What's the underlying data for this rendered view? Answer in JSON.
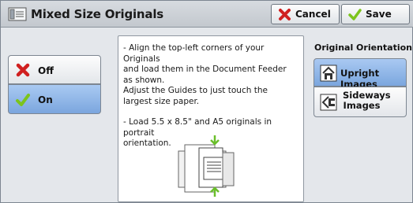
{
  "header": {
    "title": "Mixed Size Originals",
    "title_icon": "document-stack-icon",
    "cancel_label": "Cancel",
    "save_label": "Save"
  },
  "toggle": {
    "off_label": "Off",
    "on_label": "On",
    "selected": "On"
  },
  "info": {
    "paragraph1": "- Align the top-left corners of your Originals\n  and load them in the Document Feeder\n  as shown.\n  Adjust the Guides to just touch the\n  largest size paper.",
    "paragraph2": "- Load 5.5 x 8.5\" and A5 originals in portrait\n  orientation."
  },
  "orientation": {
    "title": "Original Orientation",
    "upright_label": "Upright Images",
    "sideways_label": "Sideways\nImages",
    "selected": "Upright Images"
  },
  "colors": {
    "selected_blue": "#7ba6de",
    "cancel_red": "#d02020",
    "save_green": "#7cc41c"
  }
}
